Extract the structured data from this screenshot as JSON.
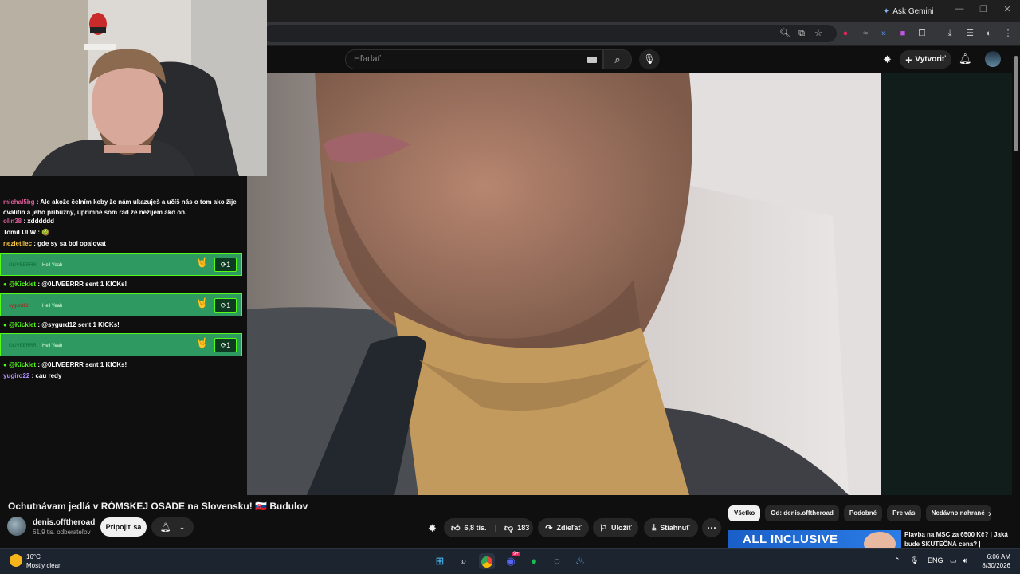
{
  "browser": {
    "ask_gemini": "Ask Gemini",
    "window_controls": [
      "minimize-icon",
      "restore-icon",
      "close-icon"
    ],
    "toolbar_icons": [
      "zoom-icon",
      "cast-icon",
      "bookmark-star-icon",
      "extension-icon",
      "download-icon",
      "playlist-icon",
      "profile-avatar-icon",
      "menu-icon"
    ]
  },
  "youtube": {
    "search_placeholder": "Hľadať",
    "create_label": "Vytvoriť"
  },
  "chat": {
    "lines": [
      {
        "user": "michal5bg",
        "user_color": "#e05d9a",
        "text": " : Ale akože čelním keby že nám ukazuješ a učíš nás o tom ako žije cvalifin a jeho príbuzný, úprimne som rad ze nežijem ako on."
      },
      {
        "user": "olin38",
        "user_color": "#e05d9a",
        "text": " : xdddddd"
      },
      {
        "user": "TomiLULW",
        "user_color": "#ffffff",
        "text": " : 🥝"
      },
      {
        "user": "nezletilec",
        "user_color": "#f5c542",
        "text": " : gde sy sa bol opalovat"
      },
      {
        "kick": true,
        "name": "OLIVEERRR",
        "msg": "Hell Yeah",
        "count": "1"
      },
      {
        "user": "@Kicklet",
        "user_color": "#53fc18",
        "text": " : @0LIVEERRR sent 1 KICKs!"
      },
      {
        "kick": true,
        "name": "sygurd12",
        "msg": "Hell Yeah",
        "count": "1"
      },
      {
        "user": "@Kicklet",
        "user_color": "#53fc18",
        "text": " : @sygurd12 sent 1 KICKs!"
      },
      {
        "kick": true,
        "name": "OLIVEERRR",
        "msg": "Hell Yeah",
        "count": "1"
      },
      {
        "user": "@Kicklet",
        "user_color": "#53fc18",
        "text": " : @0LIVEERRR sent 1 KICKs!"
      },
      {
        "user": "yugiro22",
        "user_color": "#b28cff",
        "text": " : cau redy"
      }
    ]
  },
  "video": {
    "title": "Ochutnávam jedlá v RÓMSKEJ OSADE na Slovensku! 🇸🇰 Budulov",
    "channel": "denis.offtheroad",
    "subscribers": "61,9 tis. odberateľov",
    "join_label": "Pripojiť sa",
    "likes": "6,8 tis.",
    "dislikes": "183",
    "share_label": "Zdieľať",
    "save_label": "Uložiť",
    "download_label": "Stiahnuť"
  },
  "related": {
    "chips": [
      "Všetko",
      "Od: denis.offtheroad",
      "Podobné",
      "Pre vás",
      "Nedávno nahrané"
    ],
    "first_title": "Plavba na MSC za 6500 Kč? | Jaká bude SKUTEČNÁ cena? |",
    "thumb_text": "ALL INCLUSIVE"
  },
  "taskbar": {
    "temperature": "16°C",
    "weather": "Mostly clear",
    "language": "ENG",
    "time": "6:06 AM",
    "date": "8/30/2026",
    "discord_badge": "9+"
  }
}
